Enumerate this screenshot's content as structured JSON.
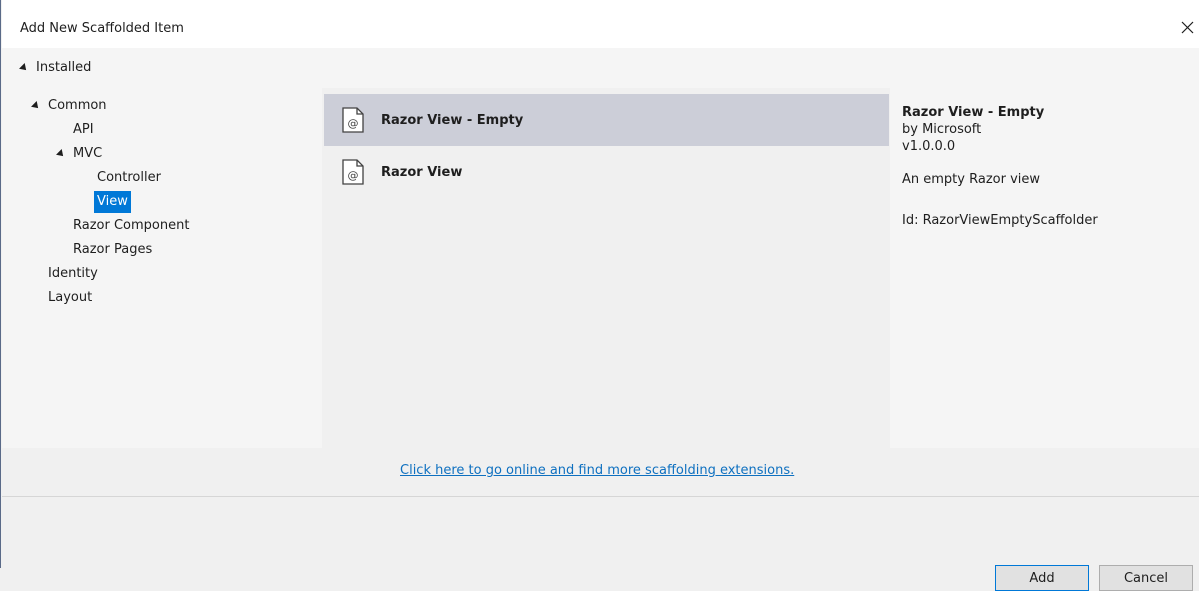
{
  "window": {
    "title": "Add New Scaffolded Item"
  },
  "installed": {
    "label": "Installed"
  },
  "tree": {
    "common": "Common",
    "api": "API",
    "mvc": "MVC",
    "controller": "Controller",
    "view": "View",
    "razor_component": "Razor Component",
    "razor_pages": "Razor Pages",
    "identity": "Identity",
    "layout": "Layout"
  },
  "templates": [
    {
      "label": "Razor View - Empty",
      "selected": true
    },
    {
      "label": "Razor View",
      "selected": false
    }
  ],
  "details": {
    "title": "Razor View - Empty",
    "author": "by Microsoft",
    "version": "v1.0.0.0",
    "description": "An empty Razor view",
    "id": "Id: RazorViewEmptyScaffolder"
  },
  "online_link": "Click here to go online and find more scaffolding extensions.",
  "buttons": {
    "add": "Add",
    "cancel": "Cancel"
  },
  "colors": {
    "selection_blue": "#0078d7",
    "list_selected": "#ccced8",
    "link": "#0e70c0"
  }
}
